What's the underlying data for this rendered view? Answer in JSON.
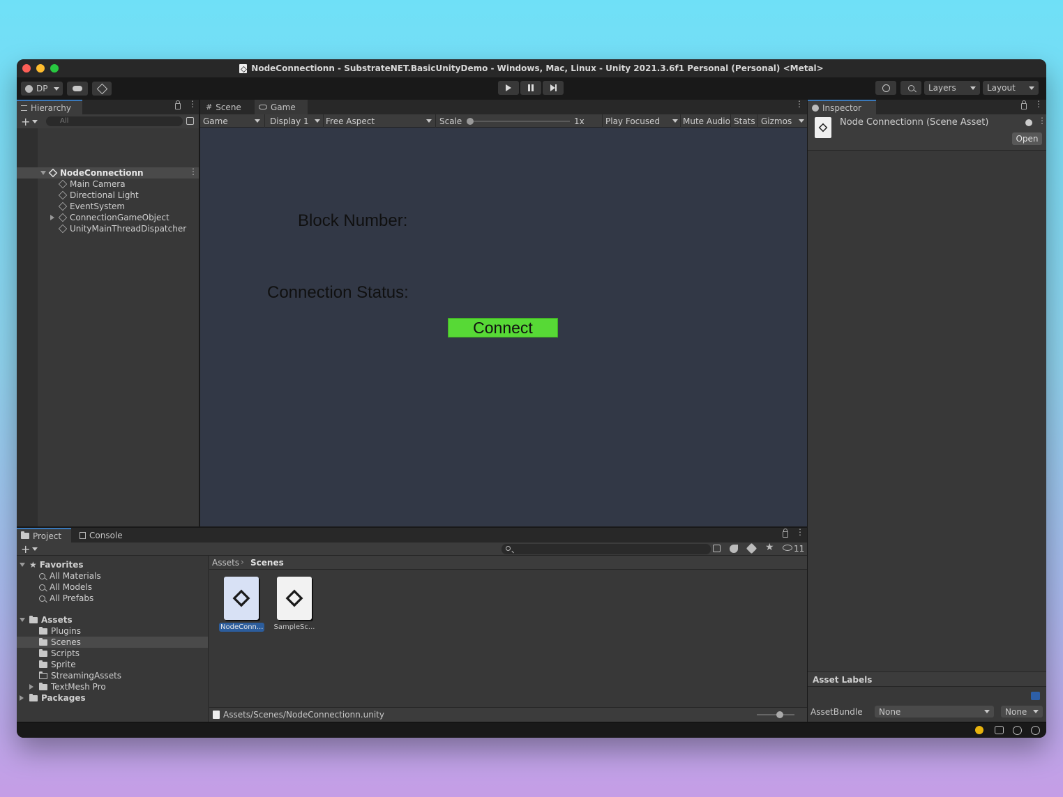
{
  "window": {
    "title": "NodeConnectionn - SubstrateNET.BasicUnityDemo - Windows, Mac, Linux - Unity 2021.3.6f1 Personal (Personal) <Metal>"
  },
  "toolbar": {
    "account_label": "DP",
    "layers_label": "Layers",
    "layout_label": "Layout"
  },
  "hierarchy": {
    "tab_label": "Hierarchy",
    "search_placeholder": "All",
    "scene_name": "NodeConnectionn",
    "items": [
      {
        "label": "Main Camera"
      },
      {
        "label": "Directional Light"
      },
      {
        "label": "EventSystem"
      },
      {
        "label": "ConnectionGameObject"
      },
      {
        "label": "UnityMainThreadDispatcher"
      }
    ]
  },
  "game_panel": {
    "tabs": [
      {
        "label": "Scene"
      },
      {
        "label": "Game"
      }
    ],
    "mode": "Game",
    "display": "Display 1",
    "aspect": "Free Aspect",
    "scale_label": "Scale",
    "scale_value": "1x",
    "play_focused": "Play Focused",
    "mute_audio": "Mute Audio",
    "stats": "Stats",
    "gizmos": "Gizmos",
    "view": {
      "block_number_label": "Block Number:",
      "connection_status_label": "Connection Status:",
      "connect_button": "Connect"
    }
  },
  "inspector": {
    "tab_label": "Inspector",
    "asset_title": "Node Connectionn (Scene Asset)",
    "open_button": "Open",
    "asset_labels_header": "Asset Labels",
    "asset_bundle_label": "AssetBundle",
    "asset_bundle_value": "None",
    "asset_bundle_variant": "None"
  },
  "project": {
    "tabs": [
      {
        "label": "Project"
      },
      {
        "label": "Console"
      }
    ],
    "hidden_count": "11",
    "favorites_label": "Favorites",
    "favorites": [
      {
        "label": "All Materials"
      },
      {
        "label": "All Models"
      },
      {
        "label": "All Prefabs"
      }
    ],
    "assets_label": "Assets",
    "folders": [
      {
        "label": "Plugins"
      },
      {
        "label": "Scenes"
      },
      {
        "label": "Scripts"
      },
      {
        "label": "Sprite"
      },
      {
        "label": "StreamingAssets"
      },
      {
        "label": "TextMesh Pro"
      }
    ],
    "packages_label": "Packages",
    "breadcrumb": [
      {
        "label": "Assets"
      },
      {
        "label": "Scenes"
      }
    ],
    "assets": [
      {
        "label": "NodeConn..."
      },
      {
        "label": "SampleSc..."
      }
    ],
    "selected_path": "Assets/Scenes/NodeConnectionn.unity"
  },
  "colors": {
    "accent": "#3a79bb",
    "connect_button": "#57d936",
    "game_view_bg": "#323846",
    "panel_bg": "#383838"
  }
}
